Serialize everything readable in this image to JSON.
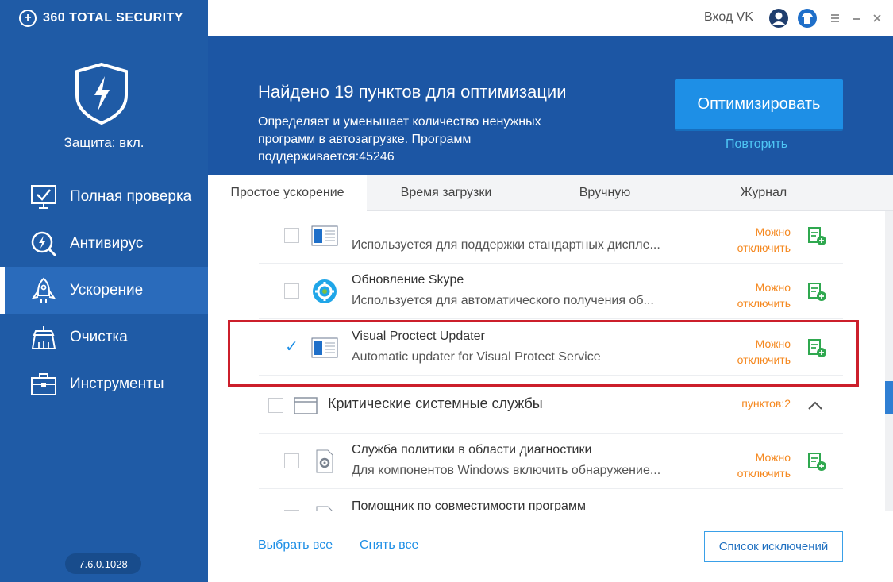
{
  "app": {
    "name": "360 TOTAL SECURITY",
    "logo_icon": "plus-circle-icon"
  },
  "sidebar": {
    "protection_status": "Защита: вкл.",
    "items": [
      {
        "label": "Полная проверка",
        "icon": "monitor-check-icon"
      },
      {
        "label": "Антивирус",
        "icon": "bolt-search-icon"
      },
      {
        "label": "Ускорение",
        "icon": "rocket-icon"
      },
      {
        "label": "Очистка",
        "icon": "broom-icon"
      },
      {
        "label": "Инструменты",
        "icon": "toolbox-icon"
      }
    ],
    "active_item": "Ускорение",
    "version": "7.6.0.1028"
  },
  "topbar": {
    "login_label": "Вход VK"
  },
  "header": {
    "title": "Найдено 19 пунктов для оптимизации",
    "description": "Определяет и уменьшает количество ненужных программ в автозагрузке. Программ поддерживается:45246",
    "optimize_label": "Оптимизировать",
    "repeat_label": "Повторить"
  },
  "tabs": [
    {
      "label": "Простое ускорение",
      "active": true
    },
    {
      "label": "Время загрузки",
      "active": false
    },
    {
      "label": "Вручную",
      "active": false
    },
    {
      "label": "Журнал",
      "active": false
    }
  ],
  "list": {
    "status_line1": "Можно",
    "status_line2": "отключить",
    "rows": [
      {
        "name": "",
        "sub": "Используется для поддержки стандартных диспле...",
        "checked": false,
        "icon": "window-icon"
      },
      {
        "name": "Обновление Skype",
        "sub": "Используется для автоматического получения об...",
        "checked": false,
        "icon": "skype-update-icon"
      },
      {
        "name": "Visual Proctect Updater",
        "sub": "Automatic updater for Visual Protect Service",
        "checked": true,
        "icon": "window-icon"
      }
    ],
    "group": {
      "name": "Критические системные службы",
      "count": "пунктов:2",
      "icon": "window-frame-icon"
    },
    "rows2": [
      {
        "name": "Служба политики в области диагностики",
        "sub": "Для компонентов Windows включить обнаружение...",
        "checked": false,
        "icon": "gear-document-icon"
      },
      {
        "name": "Помощник по совместимости программ",
        "sub": "",
        "checked": false,
        "icon": "document-icon"
      }
    ]
  },
  "bottom": {
    "select_all": "Выбрать все",
    "deselect_all": "Снять все",
    "exclusions": "Список исключений"
  },
  "colors": {
    "sidebar": "#1f5ba6",
    "header": "#1c56a4",
    "accent": "#1e8fe6",
    "status": "#f5881f",
    "highlight": "#cc1f2b",
    "add_icon": "#2fa84f"
  }
}
